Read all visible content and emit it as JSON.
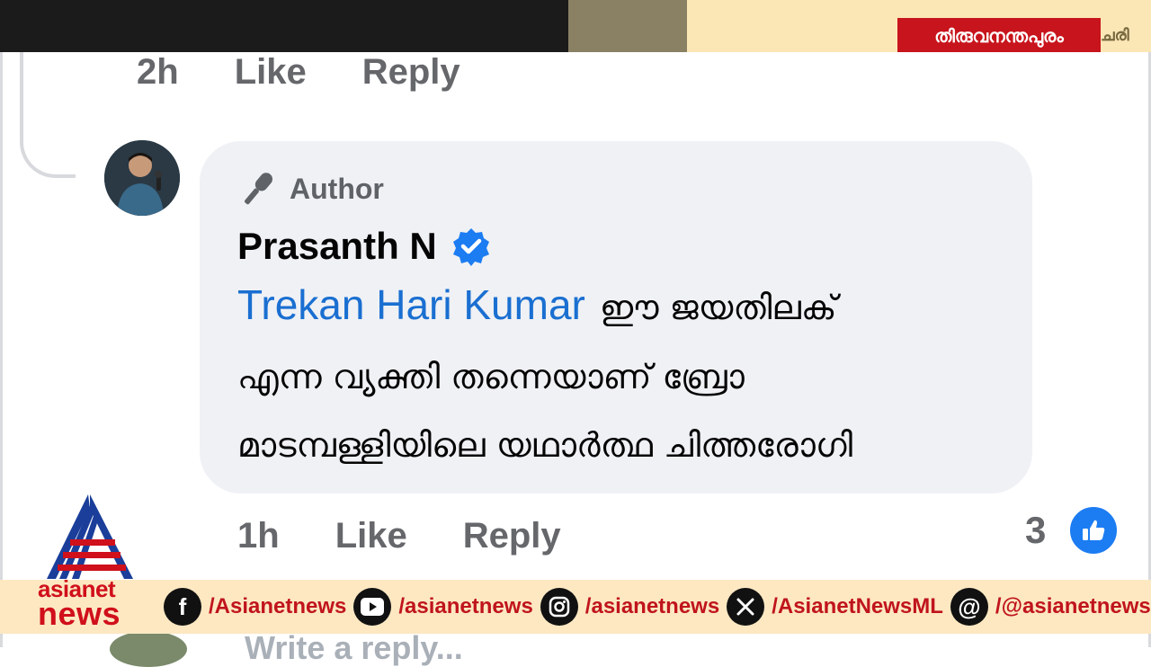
{
  "broadcast": {
    "location_tag": "തിരുവനന്തപുരം",
    "location_tag_overflow": "ചരി"
  },
  "previous_comment": {
    "time": "2h",
    "like_label": "Like",
    "reply_label": "Reply"
  },
  "comment": {
    "author_badge_label": "Author",
    "author_name": "Prasanth N",
    "verified": true,
    "mention": "Trekan Hari Kumar",
    "text_line1": "ഈ ജയതിലക്",
    "text_line2": "എന്ന വ്യക്തി തന്നെയാണ് ബ്രോ",
    "text_line3": "മാടമ്പള്ളിയിലെ യഥാർത്ഥ ചിത്തരോഗി",
    "time": "1h",
    "like_label": "Like",
    "reply_label": "Reply",
    "reaction_count": "3",
    "reaction_icon": "like-thumb-icon"
  },
  "write_reply_placeholder": "Write a reply...",
  "channel": {
    "logo_line1": "asianet",
    "logo_line2": "news",
    "brand_color": "#d0101b",
    "socials": [
      {
        "icon": "facebook-icon",
        "handle": "/Asianetnews"
      },
      {
        "icon": "youtube-icon",
        "handle": "/asianetnews"
      },
      {
        "icon": "instagram-icon",
        "handle": "/asianetnews"
      },
      {
        "icon": "x-icon",
        "handle": "/AsianetNewsML"
      },
      {
        "icon": "threads-icon",
        "handle": "/@asianetnews"
      }
    ]
  },
  "colors": {
    "mention_blue": "#1a6fd1",
    "verified_blue": "#1c7cf2",
    "bubble_bg": "#eff1f5",
    "meta_gray": "#65676b"
  }
}
